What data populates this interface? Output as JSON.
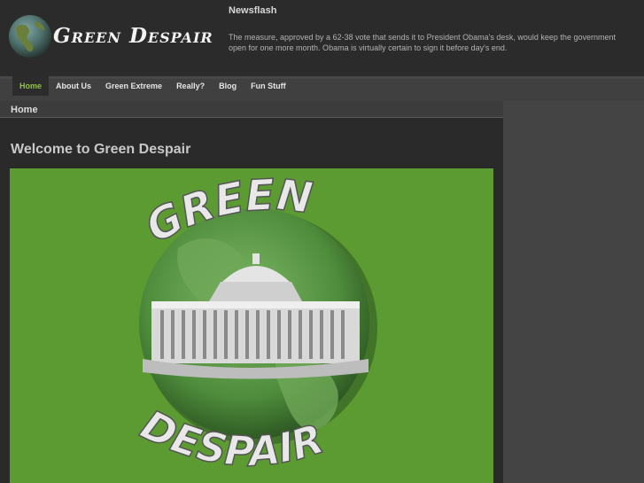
{
  "site": {
    "logo_text": "Green Despair"
  },
  "newsflash": {
    "title": "Newsflash",
    "text": "The measure, approved by a 62-38 vote that sends it to President Obama's desk, would keep the government open for one more month. Obama is virtually certain to sign it before day's end."
  },
  "nav": {
    "items": [
      {
        "label": "Home"
      },
      {
        "label": "About Us"
      },
      {
        "label": "Green Extreme"
      },
      {
        "label": "Really?"
      },
      {
        "label": "Blog"
      },
      {
        "label": "Fun Stuff"
      }
    ],
    "active": "Home"
  },
  "breadcrumb": "Home",
  "main": {
    "title": "Welcome to Green Despair",
    "banner": {
      "top_word": "GREEN",
      "bottom_word": "DESPAIR"
    }
  },
  "colors": {
    "accent": "#8ec63f",
    "header_bg": "#2b2b2b",
    "banner_bg": "#5c9a32"
  }
}
